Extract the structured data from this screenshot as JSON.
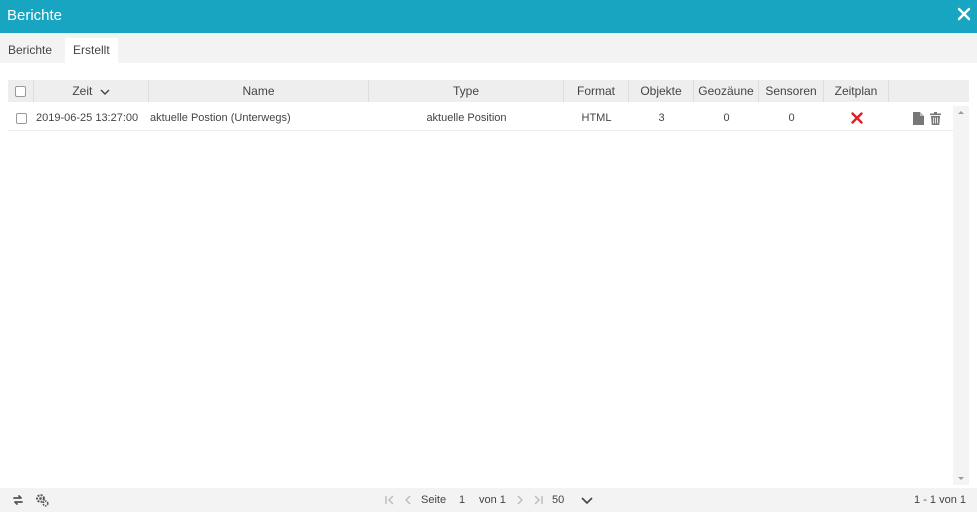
{
  "window": {
    "title": "Berichte"
  },
  "tabs": [
    {
      "label": "Berichte"
    },
    {
      "label": "Erstellt"
    }
  ],
  "table": {
    "columns": [
      "Zeit",
      "Name",
      "Type",
      "Format",
      "Objekte",
      "Geozäune",
      "Sensoren",
      "Zeitplan"
    ],
    "sort": {
      "column": "Zeit",
      "direction": "descending"
    },
    "rows": [
      {
        "zeit": "2019-06-25 13:27:00",
        "name": "aktuelle Postion (Unterwegs)",
        "type": "aktuelle Position",
        "format": "HTML",
        "objekte": "3",
        "geozaune": "0",
        "sensoren": "0",
        "zeitplan_icon": "x-icon"
      }
    ]
  },
  "pagination": {
    "page_label": "Seite",
    "page": "1",
    "of_label": "von 1",
    "page_size": "50",
    "summary": "1 - 1 von 1"
  },
  "colors": {
    "titlebar": "#17a5c2",
    "delete_x": "#e02020",
    "icon_gray": "#777777"
  }
}
